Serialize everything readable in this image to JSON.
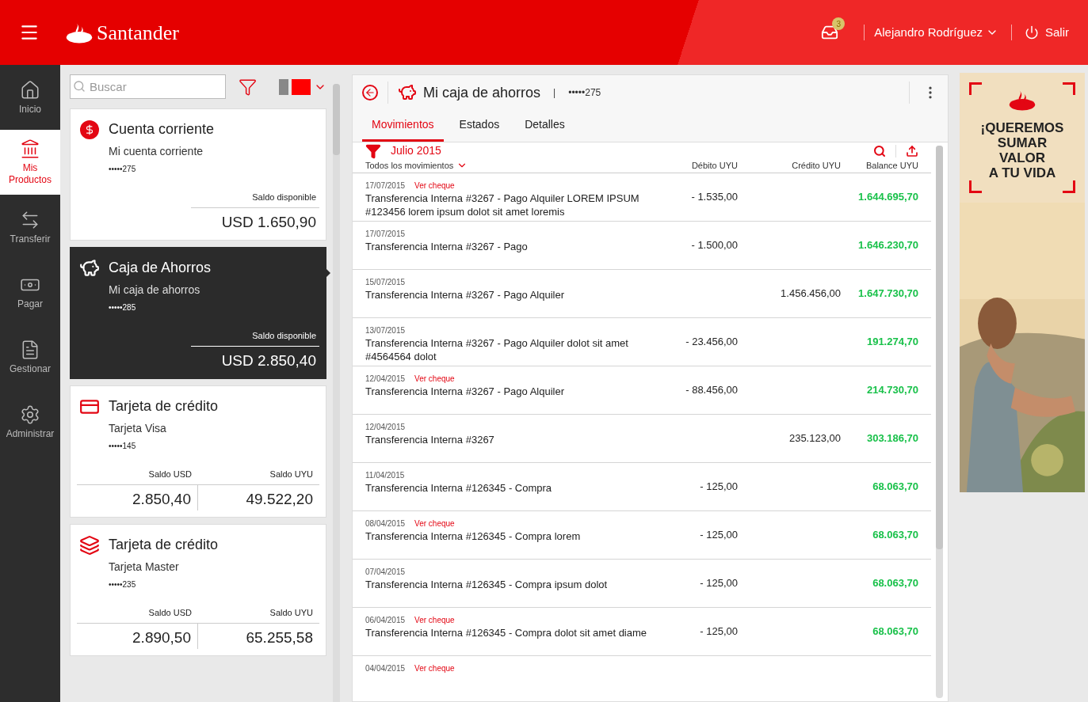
{
  "header": {
    "brand": "Santander",
    "notifications": "3",
    "user": "Alejandro Rodríguez",
    "logout": "Salir"
  },
  "nav": [
    {
      "label": "Inicio",
      "selected": false
    },
    {
      "label": "Mis Productos",
      "selected": true
    },
    {
      "label": "Transferir",
      "selected": false
    },
    {
      "label": "Pagar",
      "selected": false
    },
    {
      "label": "Gestionar",
      "selected": false
    },
    {
      "label": "Administrar",
      "selected": false
    }
  ],
  "search": {
    "placeholder": "Buscar"
  },
  "products": [
    {
      "kind": "account",
      "title": "Cuenta corriente",
      "name": "Mi cuenta corriente",
      "number": "•••••275",
      "balance_label": "Saldo disponible",
      "balance": "USD 1.650,90",
      "selected": false
    },
    {
      "kind": "account",
      "title": "Caja de Ahorros",
      "name": "Mi caja de ahorros",
      "number": "•••••285",
      "balance_label": "Saldo disponible",
      "balance": "USD 2.850,40",
      "selected": true
    },
    {
      "kind": "card",
      "title": "Tarjeta de crédito",
      "name": "Tarjeta Visa",
      "number": "•••••145",
      "balances": [
        {
          "label": "Saldo USD",
          "value": "2.850,40"
        },
        {
          "label": "Saldo UYU",
          "value": "49.522,20"
        }
      ],
      "selected": false
    },
    {
      "kind": "card",
      "title": "Tarjeta de crédito",
      "name": "Tarjeta Master",
      "number": "•••••235",
      "balances": [
        {
          "label": "Saldo USD",
          "value": "2.890,50"
        },
        {
          "label": "Saldo UYU",
          "value": "65.255,58"
        }
      ],
      "selected": false
    }
  ],
  "detail": {
    "title": "Mi caja de ahorros",
    "separator": "|",
    "number": "•••••275",
    "tabs": [
      {
        "label": "Movimientos",
        "selected": true
      },
      {
        "label": "Estados",
        "selected": false
      },
      {
        "label": "Detalles",
        "selected": false
      }
    ],
    "period": "Julio 2015",
    "columns": [
      "Todos los movimientos",
      "Débito UYU",
      "Crédito UYU",
      "Balance UYU"
    ],
    "rows": [
      {
        "date": "17/07/2015",
        "link": "Ver cheque",
        "description": "Transferencia Interna #3267 - Pago Alquiler LOREM IPSUM #123456 lorem ipsum dolot sit amet loremis",
        "debit": "- 1.535,00",
        "balance": "1.644.695,70"
      },
      {
        "date": "17/07/2015",
        "description": "Transferencia Interna #3267 - Pago",
        "debit": "- 1.500,00",
        "balance": "1.646.230,70"
      },
      {
        "date": "15/07/2015",
        "description": "Transferencia Interna #3267 - Pago Alquiler",
        "credit": "1.456.456,00",
        "balance": "1.647.730,70"
      },
      {
        "date": "13/07/2015",
        "description": "Transferencia Interna #3267 - Pago Alquiler dolot sit amet #4564564 dolot",
        "debit": "- 23.456,00",
        "balance": "191.274,70"
      },
      {
        "date": "12/04/2015",
        "link": "Ver cheque",
        "description": "Transferencia Interna #3267 - Pago Alquiler",
        "debit": "- 88.456,00",
        "balance": "214.730,70"
      },
      {
        "date": "12/04/2015",
        "description": "Transferencia Interna #3267",
        "credit": "235.123,00",
        "balance": "303.186,70"
      },
      {
        "date": "11/04/2015",
        "description": "Transferencia Interna #126345 - Compra",
        "debit": "- 125,00",
        "balance": "68.063,70"
      },
      {
        "date": "08/04/2015",
        "link": "Ver cheque",
        "description": "Transferencia Interna #126345 - Compra lorem",
        "debit": "- 125,00",
        "balance": "68.063,70"
      },
      {
        "date": "07/04/2015",
        "description": "Transferencia Interna #126345 - Compra ipsum dolot",
        "debit": "- 125,00",
        "balance": "68.063,70"
      },
      {
        "date": "06/04/2015",
        "link": "Ver cheque",
        "description": "Transferencia Interna #126345 - Compra dolot sit amet diame",
        "debit": "- 125,00",
        "balance": "68.063,70"
      },
      {
        "date": "04/04/2015",
        "link": "Ver cheque"
      }
    ]
  },
  "ad": {
    "headline": [
      "¡QUEREMOS",
      "SUMAR",
      "VALOR",
      "A TU VIDA"
    ]
  }
}
